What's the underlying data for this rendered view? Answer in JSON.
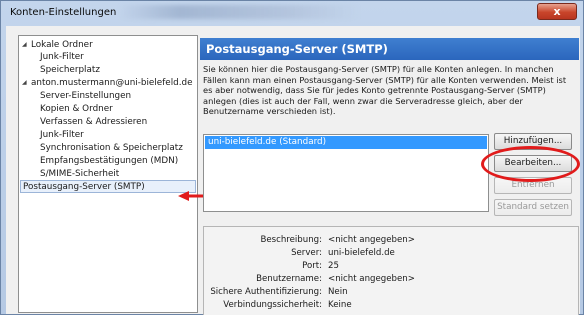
{
  "window": {
    "title": "Konten-Einstellungen",
    "close_glyph": "x"
  },
  "tree": {
    "items": [
      {
        "label": "Lokale Ordner",
        "level": 0,
        "twisty": "◢"
      },
      {
        "label": "Junk-Filter",
        "level": 1
      },
      {
        "label": "Speicherplatz",
        "level": 1
      },
      {
        "label": "anton.mustermann@uni-bielefeld.de",
        "level": 0,
        "twisty": "◢"
      },
      {
        "label": "Server-Einstellungen",
        "level": 1
      },
      {
        "label": "Kopien & Ordner",
        "level": 1
      },
      {
        "label": "Verfassen & Adressieren",
        "level": 1
      },
      {
        "label": "Junk-Filter",
        "level": 1
      },
      {
        "label": "Synchronisation & Speicherplatz",
        "level": 1
      },
      {
        "label": "Empfangsbestätigungen (MDN)",
        "level": 1
      },
      {
        "label": "S/MIME-Sicherheit",
        "level": 1
      },
      {
        "label": "Postausgang-Server (SMTP)",
        "level": 0,
        "selected": true
      }
    ]
  },
  "panel": {
    "title": "Postausgang-Server (SMTP)",
    "description": "Sie können hier die Postausgang-Server (SMTP) für alle Konten anlegen. In manchen Fällen kann man einen Postausgang-Server (SMTP) für alle Konten verwenden. Meist ist es aber notwendig, dass Sie für jedes Konto getrennte Postausgang-Server (SMTP) anlegen (dies ist auch der Fall, wenn zwar die Serveradresse gleich, aber der Benutzername verschieden ist).",
    "servers": [
      "uni-bielefeld.de (Standard)"
    ],
    "buttons": {
      "add": "Hinzufügen...",
      "edit": "Bearbeiten...",
      "remove": "Entfernen",
      "set_default": "Standard setzen"
    },
    "details": [
      {
        "label": "Beschreibung:",
        "value": "<nicht angegeben>"
      },
      {
        "label": "Server:",
        "value": "uni-bielefeld.de"
      },
      {
        "label": "Port:",
        "value": "25"
      },
      {
        "label": "Benutzername:",
        "value": "<nicht angegeben>"
      },
      {
        "label": "Sichere Authentifizierung:",
        "value": "Nein"
      },
      {
        "label": "Verbindungssicherheit:",
        "value": "Keine"
      }
    ]
  },
  "annotation_color": "#e11b1b"
}
